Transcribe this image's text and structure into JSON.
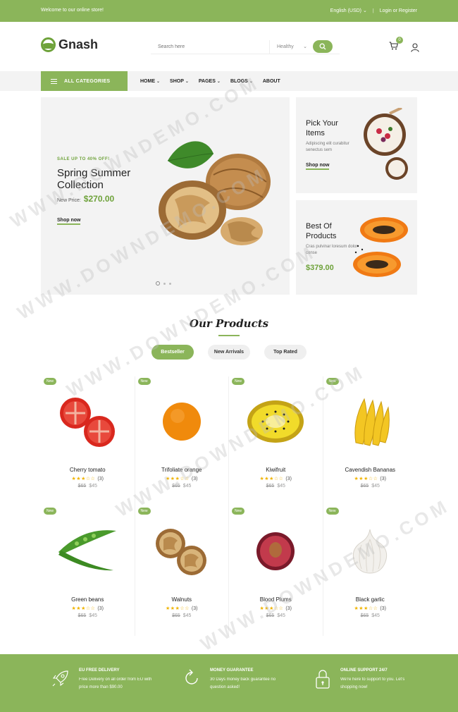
{
  "topbar": {
    "welcome": "Welcome to our online store!",
    "currency": "English (USD)",
    "login": "Login or Register"
  },
  "header": {
    "logo": "Gnash",
    "search_placeholder": "Search here",
    "search_category": "Healthy",
    "cart_count": "0"
  },
  "nav": {
    "all_categories": "ALL CATEGORIES",
    "items": [
      "HOME",
      "SHOP",
      "PAGES",
      "BLOGS",
      "ABOUT"
    ]
  },
  "hero": {
    "sale": "SALE UP TO 40% OFF!",
    "title": "Spring Summer Collection",
    "price_label": "New Price:",
    "price": "$270.00",
    "cta": "Shop now"
  },
  "side1": {
    "title": "Pick Your Items",
    "desc": "Adipiscing elit curabitur senectus sem",
    "cta": "Shop now"
  },
  "side2": {
    "title": "Best Of Products",
    "desc": "Cras pulvinar loresum dolor conse",
    "price": "$379.00"
  },
  "products_section": {
    "title": "Our Products",
    "tabs": [
      "Bestseller",
      "New Arrivals",
      "Top Rated"
    ]
  },
  "products": [
    {
      "badge": "New",
      "name": "Cherry tomato",
      "rating": 3,
      "count": "(3)",
      "old_price": "$65",
      "price": "$45"
    },
    {
      "badge": "New",
      "name": "Trifoliate orange",
      "rating": 3,
      "count": "(3)",
      "old_price": "$65",
      "price": "$45"
    },
    {
      "badge": "New",
      "name": "Kiwifruit",
      "rating": 3,
      "count": "(3)",
      "old_price": "$65",
      "price": "$45"
    },
    {
      "badge": "New",
      "name": "Cavendish Bananas",
      "rating": 3,
      "count": "(3)",
      "old_price": "$65",
      "price": "$45"
    },
    {
      "badge": "New",
      "name": "Green beans",
      "rating": 3,
      "count": "(3)",
      "old_price": "$65",
      "price": "$45"
    },
    {
      "badge": "New",
      "name": "Walnuts",
      "rating": 3,
      "count": "(3)",
      "old_price": "$65",
      "price": "$45"
    },
    {
      "badge": "New",
      "name": "Blood Plums",
      "rating": 3,
      "count": "(3)",
      "old_price": "$65",
      "price": "$45"
    },
    {
      "badge": "New",
      "name": "Black garlic",
      "rating": 3,
      "count": "(3)",
      "old_price": "$65",
      "price": "$45"
    }
  ],
  "footer": {
    "features": [
      {
        "title": "EU FREE DELIVERY",
        "desc": "Free Delivery on all order from EU with price more than $90.00",
        "icon": "rocket-icon"
      },
      {
        "title": "MONEY GUARANTEE",
        "desc": "30 Days money back guarantee no question asked!",
        "icon": "refresh-icon"
      },
      {
        "title": "ONLINE SUPPORT 24/7",
        "desc": "We're here to support to you. Let's shopping now!",
        "icon": "lock-icon"
      }
    ]
  },
  "watermark": "WWW.DOWNDEMO.COM",
  "colors": {
    "accent": "#8bb55a",
    "star": "#f0b400",
    "panel": "#f3f3f3"
  }
}
